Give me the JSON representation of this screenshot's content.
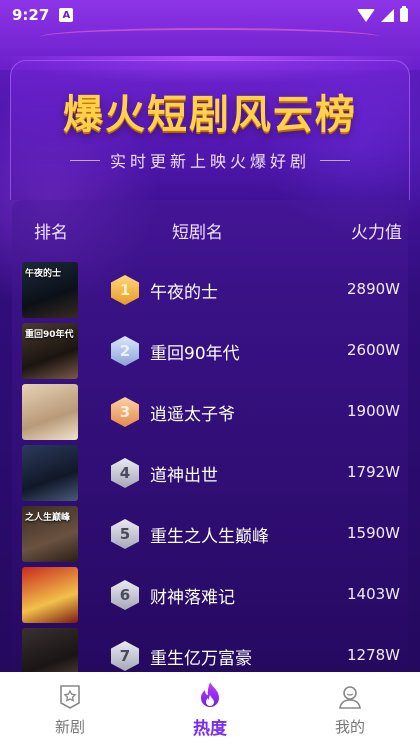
{
  "status_bar": {
    "time": "9:27",
    "app_badge": "A"
  },
  "header": {
    "title": "爆火短剧风云榜",
    "subtitle": "实时更新上映火爆好剧"
  },
  "table": {
    "col_rank": "排名",
    "col_name": "短剧名",
    "col_heat": "火力值"
  },
  "dramas": [
    {
      "rank": "1",
      "name": "午夜的士",
      "heat": "2890W",
      "cover_text": "午夜的士",
      "badge": "gold"
    },
    {
      "rank": "2",
      "name": "重回90年代",
      "heat": "2600W",
      "cover_text": "重回90年代",
      "badge": "silver"
    },
    {
      "rank": "3",
      "name": "逍遥太子爷",
      "heat": "1900W",
      "cover_text": "",
      "badge": "bronze"
    },
    {
      "rank": "4",
      "name": "道神出世",
      "heat": "1792W",
      "cover_text": "",
      "badge": "plain"
    },
    {
      "rank": "5",
      "name": "重生之人生巅峰",
      "heat": "1590W",
      "cover_text": "之人生巅峰",
      "badge": "plain"
    },
    {
      "rank": "6",
      "name": "财神落难记",
      "heat": "1403W",
      "cover_text": "",
      "badge": "plain"
    },
    {
      "rank": "7",
      "name": "重生亿万富豪",
      "heat": "1278W",
      "cover_text": "",
      "badge": "plain"
    }
  ],
  "nav": [
    {
      "label": "新剧",
      "icon": "star-icon",
      "active": false
    },
    {
      "label": "热度",
      "icon": "flame-icon",
      "active": true
    },
    {
      "label": "我的",
      "icon": "user-icon",
      "active": false
    }
  ],
  "colors": {
    "accent": "#7a2cf0",
    "title_gold": "#ffd24a",
    "background": "#300d7a"
  }
}
